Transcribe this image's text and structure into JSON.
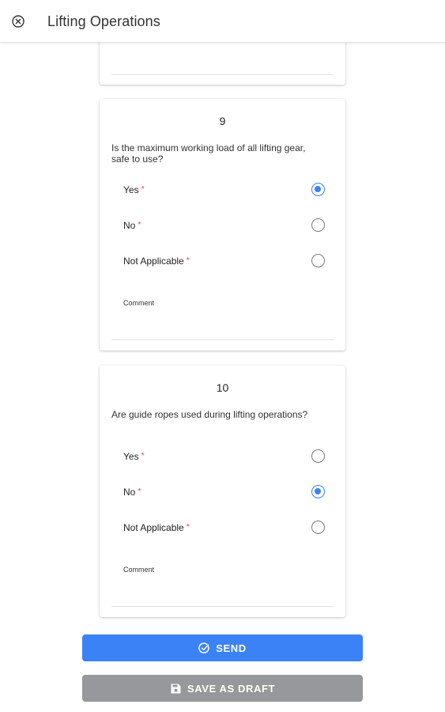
{
  "header": {
    "title": "Lifting Operations",
    "close_icon": "close-circle-icon"
  },
  "questions": [
    {
      "number": "9",
      "text": "Is the maximum working load of all lifting gear, safe to use?",
      "options": [
        {
          "label": "Yes",
          "required_mark": "*",
          "selected": true
        },
        {
          "label": "No",
          "required_mark": "*",
          "selected": false
        },
        {
          "label": "Not Applicable",
          "required_mark": "*",
          "selected": false
        }
      ],
      "comment_label": "Comment",
      "comment_value": ""
    },
    {
      "number": "10",
      "text": "Are guide ropes used during lifting operations?",
      "options": [
        {
          "label": "Yes",
          "required_mark": "*",
          "selected": false
        },
        {
          "label": "No",
          "required_mark": "*",
          "selected": true
        },
        {
          "label": "Not Applicable",
          "required_mark": "*",
          "selected": false
        }
      ],
      "comment_label": "Comment",
      "comment_value": ""
    }
  ],
  "actions": {
    "send_label": "SEND",
    "send_icon": "check-circle-icon",
    "draft_label": "SAVE AS DRAFT",
    "draft_icon": "floppy-disk-icon"
  },
  "colors": {
    "accent": "#3b82f6",
    "draft_button": "#96989b",
    "required": "#e53935"
  }
}
